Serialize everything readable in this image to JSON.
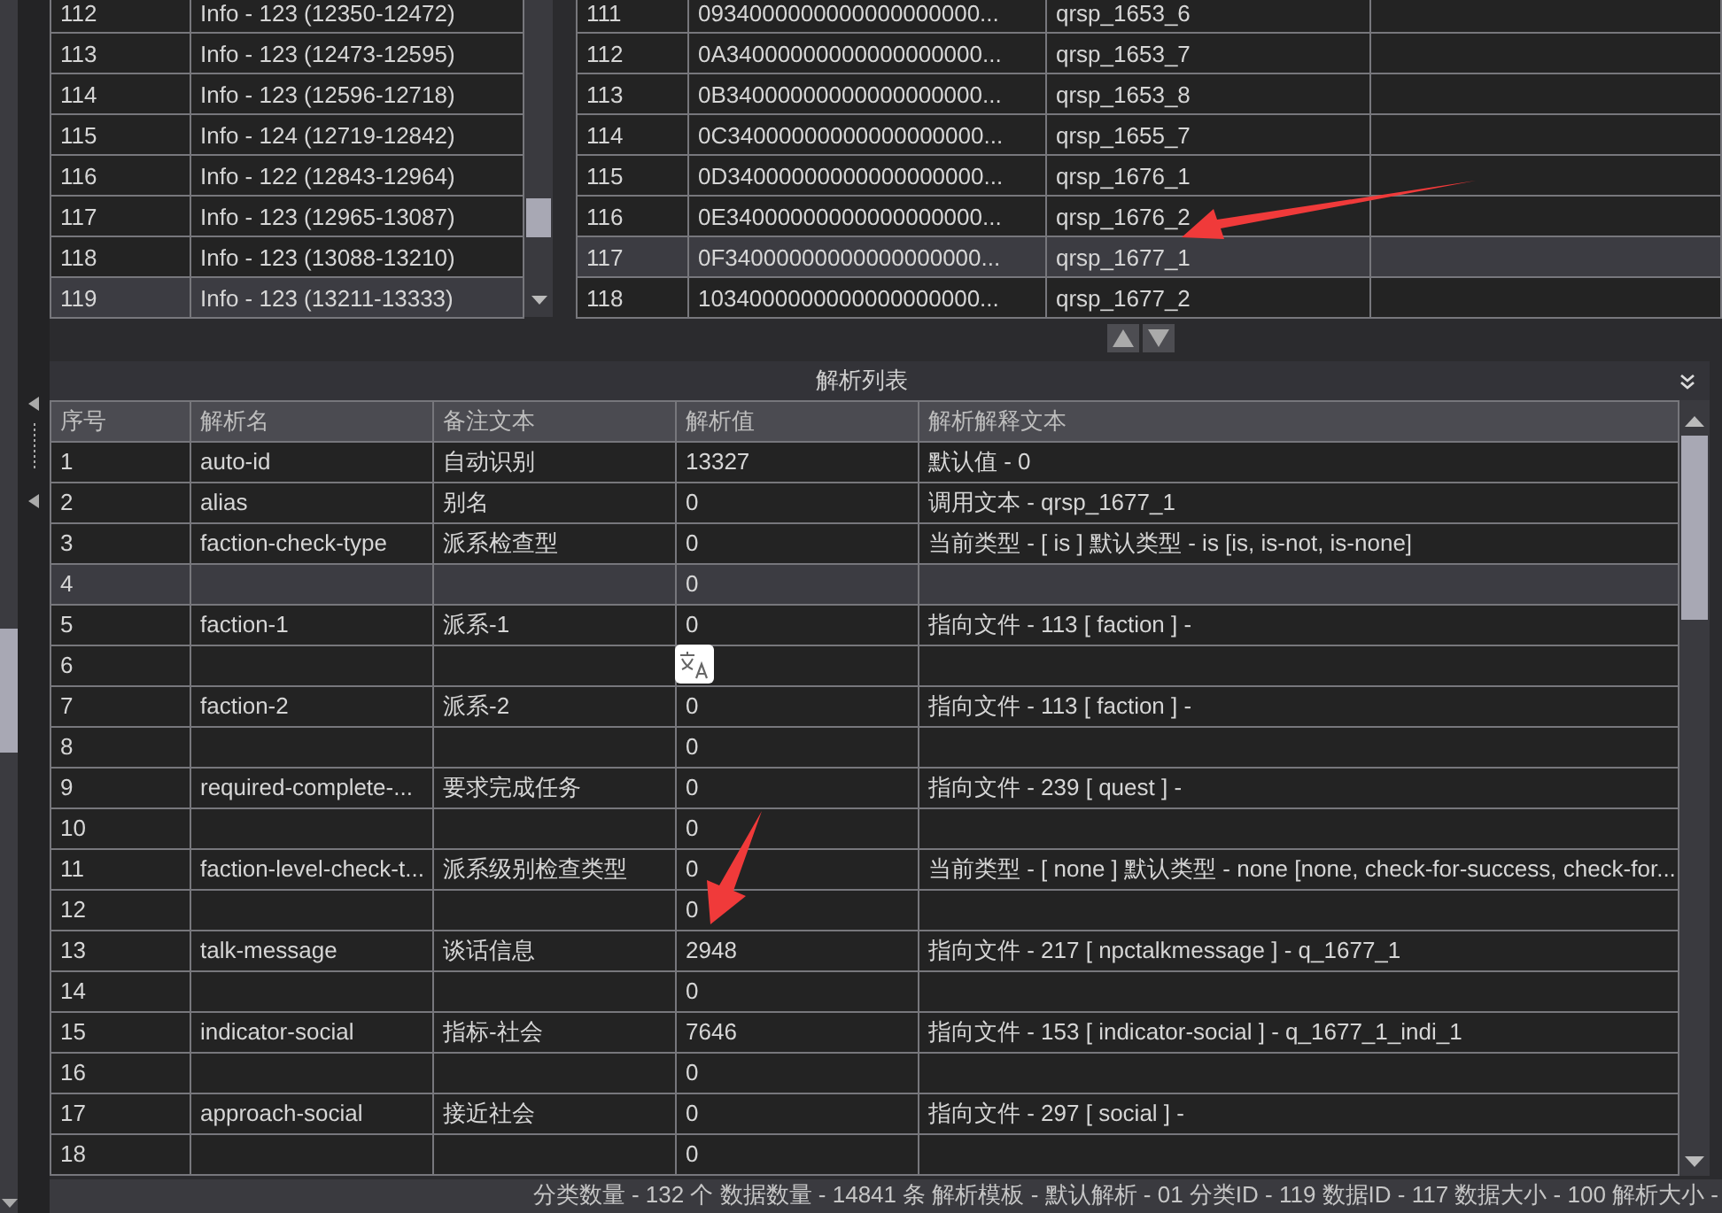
{
  "category_list": {
    "rows": [
      {
        "id": "112",
        "label": "Info - 123 (12350-12472)",
        "selected": false
      },
      {
        "id": "113",
        "label": "Info - 123 (12473-12595)",
        "selected": false
      },
      {
        "id": "114",
        "label": "Info - 123 (12596-12718)",
        "selected": false
      },
      {
        "id": "115",
        "label": "Info - 124 (12719-12842)",
        "selected": false
      },
      {
        "id": "116",
        "label": "Info - 122 (12843-12964)",
        "selected": false
      },
      {
        "id": "117",
        "label": "Info - 123 (12965-13087)",
        "selected": false
      },
      {
        "id": "118",
        "label": "Info - 123 (13088-13210)",
        "selected": false
      },
      {
        "id": "119",
        "label": "Info - 123 (13211-13333)",
        "selected": true
      }
    ]
  },
  "record_table": {
    "rows": [
      {
        "index": "111",
        "hex": "0934000000000000000000...",
        "name": "qrsp_1653_6",
        "selected": false
      },
      {
        "index": "112",
        "hex": "0A34000000000000000000...",
        "name": "qrsp_1653_7",
        "selected": false
      },
      {
        "index": "113",
        "hex": "0B34000000000000000000...",
        "name": "qrsp_1653_8",
        "selected": false
      },
      {
        "index": "114",
        "hex": "0C34000000000000000000...",
        "name": "qrsp_1655_7",
        "selected": false
      },
      {
        "index": "115",
        "hex": "0D34000000000000000000...",
        "name": "qrsp_1676_1",
        "selected": false
      },
      {
        "index": "116",
        "hex": "0E34000000000000000000...",
        "name": "qrsp_1676_2",
        "selected": false
      },
      {
        "index": "117",
        "hex": "0F34000000000000000000...",
        "name": "qrsp_1677_1",
        "selected": true
      },
      {
        "index": "118",
        "hex": "1034000000000000000000...",
        "name": "qrsp_1677_2",
        "selected": false
      }
    ]
  },
  "parse_panel": {
    "title": "解析列表",
    "columns": [
      "序号",
      "解析名",
      "备注文本",
      "解析值",
      "解析解释文本"
    ],
    "rows": [
      {
        "no": "1",
        "name": "auto-id",
        "note": "自动识别",
        "value": "13327",
        "explanation": "默认值 - 0",
        "selected": false
      },
      {
        "no": "2",
        "name": "alias",
        "note": "别名",
        "value": "0",
        "explanation": "调用文本 - qrsp_1677_1",
        "selected": false
      },
      {
        "no": "3",
        "name": "faction-check-type",
        "note": "派系检查型",
        "value": "0",
        "explanation": "当前类型 - [ is ] 默认类型 - is [is, is-not, is-none]",
        "selected": false
      },
      {
        "no": "4",
        "value": "0",
        "selected": true
      },
      {
        "no": "5",
        "name": "faction-1",
        "note": "派系-1",
        "value": "0",
        "explanation": "指向文件 - 113 [ faction ] -",
        "selected": false
      },
      {
        "no": "6",
        "selected": false
      },
      {
        "no": "7",
        "name": "faction-2",
        "note": "派系-2",
        "value": "0",
        "explanation": "指向文件 - 113 [ faction ] -",
        "selected": false
      },
      {
        "no": "8",
        "value": "0",
        "selected": false
      },
      {
        "no": "9",
        "name": "required-complete-...",
        "note": "要求完成任务",
        "value": "0",
        "explanation": "指向文件 - 239 [ quest ] -",
        "selected": false
      },
      {
        "no": "10",
        "value": "0",
        "selected": false
      },
      {
        "no": "11",
        "name": "faction-level-check-t...",
        "note": "派系级别检查类型",
        "value": "0",
        "explanation": "当前类型 - [ none ] 默认类型 - none [none, check-for-success, check-for...",
        "selected": false
      },
      {
        "no": "12",
        "value": "0",
        "selected": false
      },
      {
        "no": "13",
        "name": "talk-message",
        "note": "谈话信息",
        "value": "2948",
        "explanation": "指向文件 - 217 [ npctalkmessage ] - q_1677_1",
        "selected": false
      },
      {
        "no": "14",
        "value": "0",
        "selected": false
      },
      {
        "no": "15",
        "name": "indicator-social",
        "note": "指标-社会",
        "value": "7646",
        "explanation": "指向文件 - 153 [ indicator-social ] - q_1677_1_indi_1",
        "selected": false
      },
      {
        "no": "16",
        "value": "0",
        "selected": false
      },
      {
        "no": "17",
        "name": "approach-social",
        "note": "接近社会",
        "value": "0",
        "explanation": "指向文件 - 297 [ social ] -",
        "selected": false
      },
      {
        "no": "18",
        "value": "0",
        "selected": false
      }
    ]
  },
  "status_bar": "分类数量 - 132 个 数据数量 - 14841 条 解析模板 - 默认解析 - 01 分类ID - 119 数据ID - 117 数据大小 - 100 解析大小 -"
}
